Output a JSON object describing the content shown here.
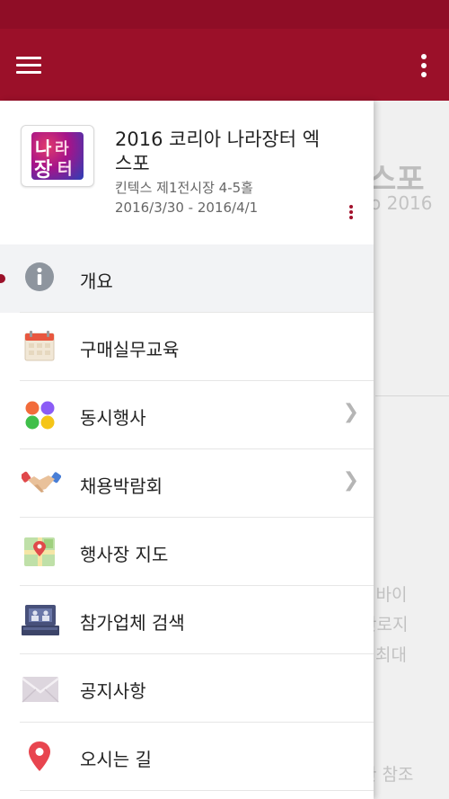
{
  "background_page": {
    "title_fragment": "스포",
    "subtitle_fragment": "o 2016",
    "text_lines": [
      "및 바이",
      "판로지",
      "최대",
      "한 참조"
    ]
  },
  "event": {
    "title": "2016 코리아 나라장터 엑스포",
    "venue": "킨텍스 제1전시장 4-5홀",
    "dates": "2016/3/30 - 2016/4/1",
    "logo_text": "나라장터"
  },
  "menu": {
    "items": [
      {
        "label": "개요",
        "icon": "info-icon",
        "active": true,
        "has_chevron": false
      },
      {
        "label": "구매실무교육",
        "icon": "calendar-icon",
        "active": false,
        "has_chevron": false
      },
      {
        "label": "동시행사",
        "icon": "four-dots-icon",
        "active": false,
        "has_chevron": true
      },
      {
        "label": "채용박람회",
        "icon": "handshake-icon",
        "active": false,
        "has_chevron": true
      },
      {
        "label": "행사장 지도",
        "icon": "map-icon",
        "active": false,
        "has_chevron": false
      },
      {
        "label": "참가업체 검색",
        "icon": "booth-icon",
        "active": false,
        "has_chevron": false
      },
      {
        "label": "공지사항",
        "icon": "mail-icon",
        "active": false,
        "has_chevron": false
      },
      {
        "label": "오시는 길",
        "icon": "location-pin-icon",
        "active": false,
        "has_chevron": false
      }
    ]
  },
  "colors": {
    "app_bar": "#9b1029",
    "status_bar": "#8f0d26",
    "accent": "#9b1029"
  }
}
